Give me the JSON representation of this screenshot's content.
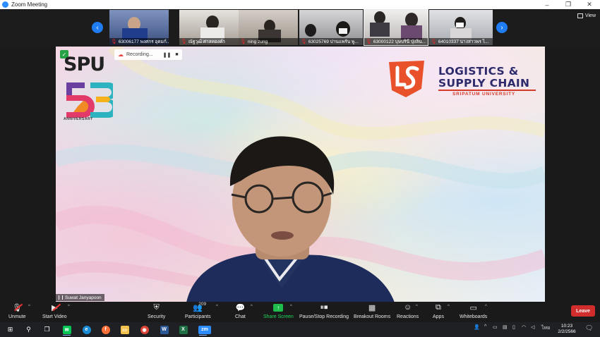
{
  "window": {
    "title": "Zoom Meeting",
    "controls": [
      "–",
      "❐",
      "✕"
    ]
  },
  "gallery": {
    "view_label": "View",
    "participants": [
      {
        "name": "63006177 พงศกร อุดมก์...",
        "muted": true,
        "bg": "#6a7ea8"
      },
      {
        "name": "ณัฐวุฒิ ศาลทองคำ",
        "muted": true,
        "bg": "#8a8680"
      },
      {
        "name": "ning zung",
        "muted": true,
        "bg": "#a59d94"
      },
      {
        "name": "63025769 ปานแพรัน พู...",
        "muted": true,
        "bg": "#9a9a9c"
      },
      {
        "name": "63000122 บุษบรินี ปุ่งลิน...",
        "muted": true,
        "bg": "#c7c4c2"
      },
      {
        "name": "64010337 นางสาวพร ไ...",
        "muted": true,
        "bg": "#b3b5b9"
      }
    ]
  },
  "main": {
    "recording_label": "Recording...",
    "spu_text": "SPU",
    "anniversary_text": "ANNIVERSARY",
    "logo_title_1": "LOGISTICS &",
    "logo_title_2": "SUPPLY CHAIN",
    "logo_subtitle": "SRIPATUM UNIVERSITY",
    "speaker_name": "Suwat Janyapoon"
  },
  "toolbar": {
    "unmute": "Unmute",
    "start_video": "Start Video",
    "security": "Security",
    "participants": "Participants",
    "participants_count": "209",
    "chat": "Chat",
    "share_screen": "Share Screen",
    "pause_stop_recording": "Pause/Stop Recording",
    "breakout_rooms": "Breakout Rooms",
    "reactions": "Reactions",
    "apps": "Apps",
    "whiteboards": "Whiteboards",
    "leave": "Leave"
  },
  "taskbar": {
    "language": "ไทย",
    "time": "10:23",
    "date": "2/2/2566"
  },
  "colors": {
    "zoom_blue": "#2d8cff",
    "share_green": "#1fbb4c",
    "leave_red": "#d12d2d",
    "logo_navy": "#2d2b6b",
    "logo_red": "#d43a2a"
  }
}
